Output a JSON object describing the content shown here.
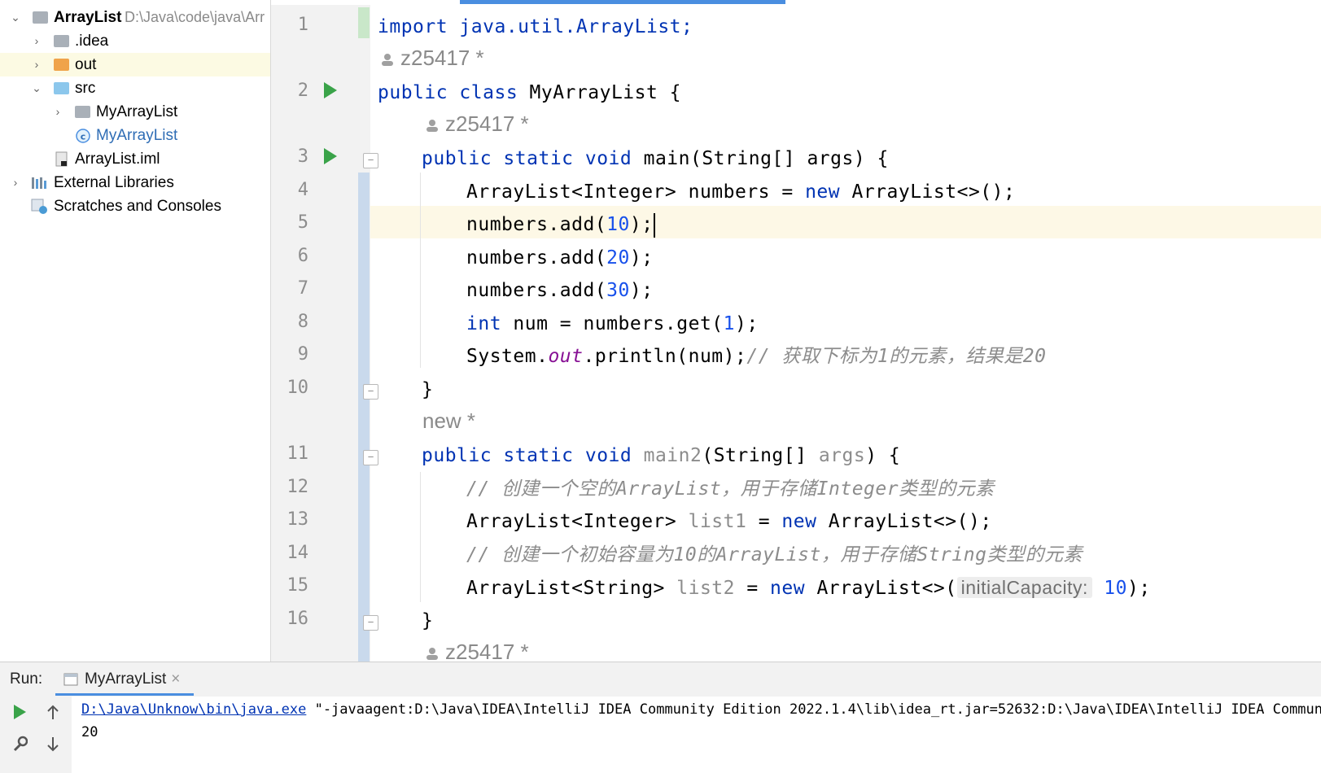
{
  "project_tree": {
    "root": {
      "name": "ArrayList",
      "path": "D:\\Java\\code\\java\\Arr"
    },
    "items": [
      {
        "label": ".idea"
      },
      {
        "label": "out"
      },
      {
        "label": "src"
      },
      {
        "label": "MyArrayList"
      },
      {
        "label": "MyArrayList"
      },
      {
        "label": "ArrayList.iml"
      },
      {
        "label": "External Libraries"
      },
      {
        "label": "Scratches and Consoles"
      }
    ]
  },
  "editor": {
    "line_numbers": [
      "1",
      "2",
      "3",
      "4",
      "5",
      "6",
      "7",
      "8",
      "9",
      "10",
      "11",
      "12",
      "13",
      "14",
      "15",
      "16"
    ],
    "author_hints": [
      "z25417 *",
      "z25417 *",
      "new *",
      "z25417 *"
    ],
    "code": {
      "l1": "import java.util.ArrayList;",
      "l2a": "public class",
      "l2b": " MyArrayList {",
      "l3a": "public static void",
      "l3b": " main(String[] args) {",
      "l4a": "ArrayList<Integer> numbers = ",
      "l4b": "new",
      "l4c": " ArrayList<>();",
      "l5a": "numbers.add(",
      "l5b": "10",
      "l5c": ");",
      "l6a": "numbers.add(",
      "l6b": "20",
      "l6c": ");",
      "l7a": "numbers.add(",
      "l7b": "30",
      "l7c": ");",
      "l8a": "int",
      "l8b": " num = numbers.get(",
      "l8c": "1",
      "l8d": ");",
      "l9a": "System.",
      "l9b": "out",
      "l9c": ".println(num);",
      "l9d": "// 获取下标为1的元素，结果是20",
      "l10": "}",
      "l11a": "public static void",
      "l11b": " main2",
      "l11c": "(String[] ",
      "l11d": "args",
      "l11e": ") {",
      "l12": "// 创建一个空的ArrayList，用于存储Integer类型的元素",
      "l13a": "ArrayList<Integer> ",
      "l13b": "list1",
      "l13c": " = ",
      "l13d": "new",
      "l13e": " ArrayList<>();",
      "l14": "// 创建一个初始容量为10的ArrayList，用于存储String类型的元素",
      "l15a": "ArrayList<String> ",
      "l15b": "list2",
      "l15c": " = ",
      "l15d": "new",
      "l15e": " ArrayList<>(",
      "l15hint": "initialCapacity:",
      "l15f": "10",
      "l15g": ");",
      "l16": "}"
    }
  },
  "run_panel": {
    "label": "Run:",
    "tab": "MyArrayList",
    "console": {
      "cmd_link": "D:\\Java\\Unknow\\bin\\java.exe",
      "cmd_rest": " \"-javaagent:D:\\Java\\IDEA\\IntelliJ IDEA Community Edition 2022.1.4\\lib\\idea_rt.jar=52632:D:\\Java\\IDEA\\IntelliJ IDEA Community",
      "output": "20"
    }
  },
  "colors": {
    "keyword": "#0033b3",
    "number": "#1750eb",
    "comment": "#8c8c8c",
    "run_green": "#3aa349",
    "accent": "#4a8ee0"
  }
}
